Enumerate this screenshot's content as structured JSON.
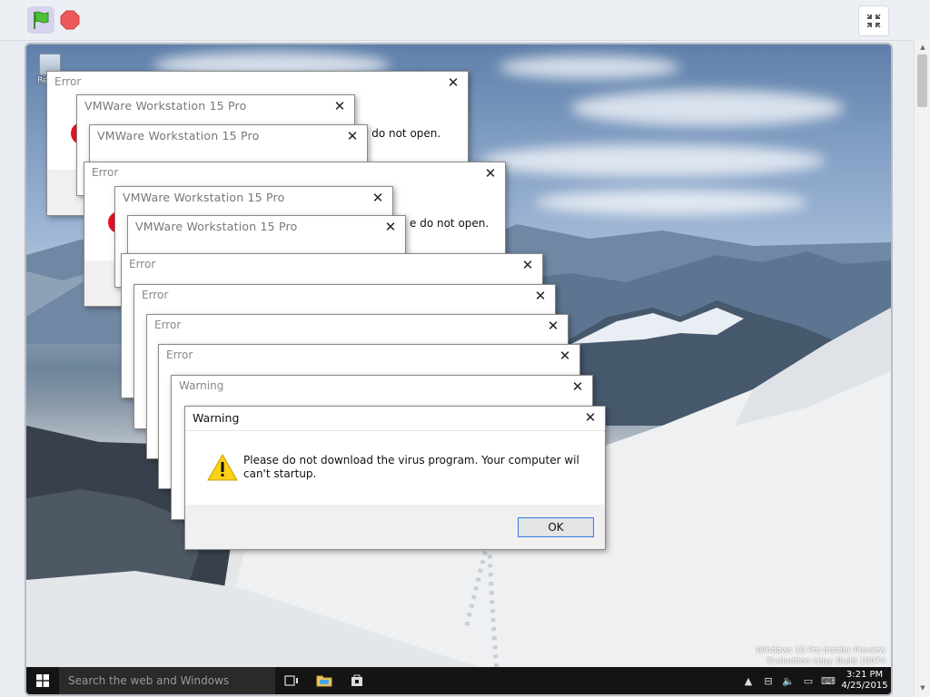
{
  "toolbar": {
    "green_flag_icon": "green-flag-icon",
    "stop_icon": "stop-icon",
    "fullscreen_icon": "exit-fullscreen-icon"
  },
  "desktop": {
    "recycle_bin_label": "Rec",
    "watermark_line1": "Windows 10 Pro Insider Preview",
    "watermark_line2": "Evaluation copy. Build 10074"
  },
  "taskbar": {
    "search_placeholder": "Search the web and Windows",
    "clock_time": "3:21 PM",
    "clock_date": "4/25/2015"
  },
  "dialogs": [
    {
      "id": "err1",
      "title": "Error",
      "message": "e do not open."
    },
    {
      "id": "vm1",
      "title": "VMWare Workstation 15 Pro"
    },
    {
      "id": "vm2",
      "title": "VMWare Workstation 15 Pro"
    },
    {
      "id": "err2",
      "title": "Error",
      "message": "e do not open."
    },
    {
      "id": "vm3",
      "title": "VMWare Workstation 15 Pro"
    },
    {
      "id": "vm4",
      "title": "VMWare Workstation 15 Pro"
    },
    {
      "id": "err3",
      "title": "Error"
    },
    {
      "id": "err4",
      "title": "Error"
    },
    {
      "id": "err5",
      "title": "Error"
    },
    {
      "id": "err6",
      "title": "Error"
    },
    {
      "id": "warn1",
      "title": "Warning"
    }
  ],
  "main_warning": {
    "title": "Warning",
    "message": "Please do not download the virus program. Your computer wil can't startup.",
    "ok_label": "OK"
  },
  "colors": {
    "error_icon": "#e81123",
    "warning_icon": "#fcd116",
    "taskbar": "#141414",
    "focus_border": "#3c7fd9"
  }
}
